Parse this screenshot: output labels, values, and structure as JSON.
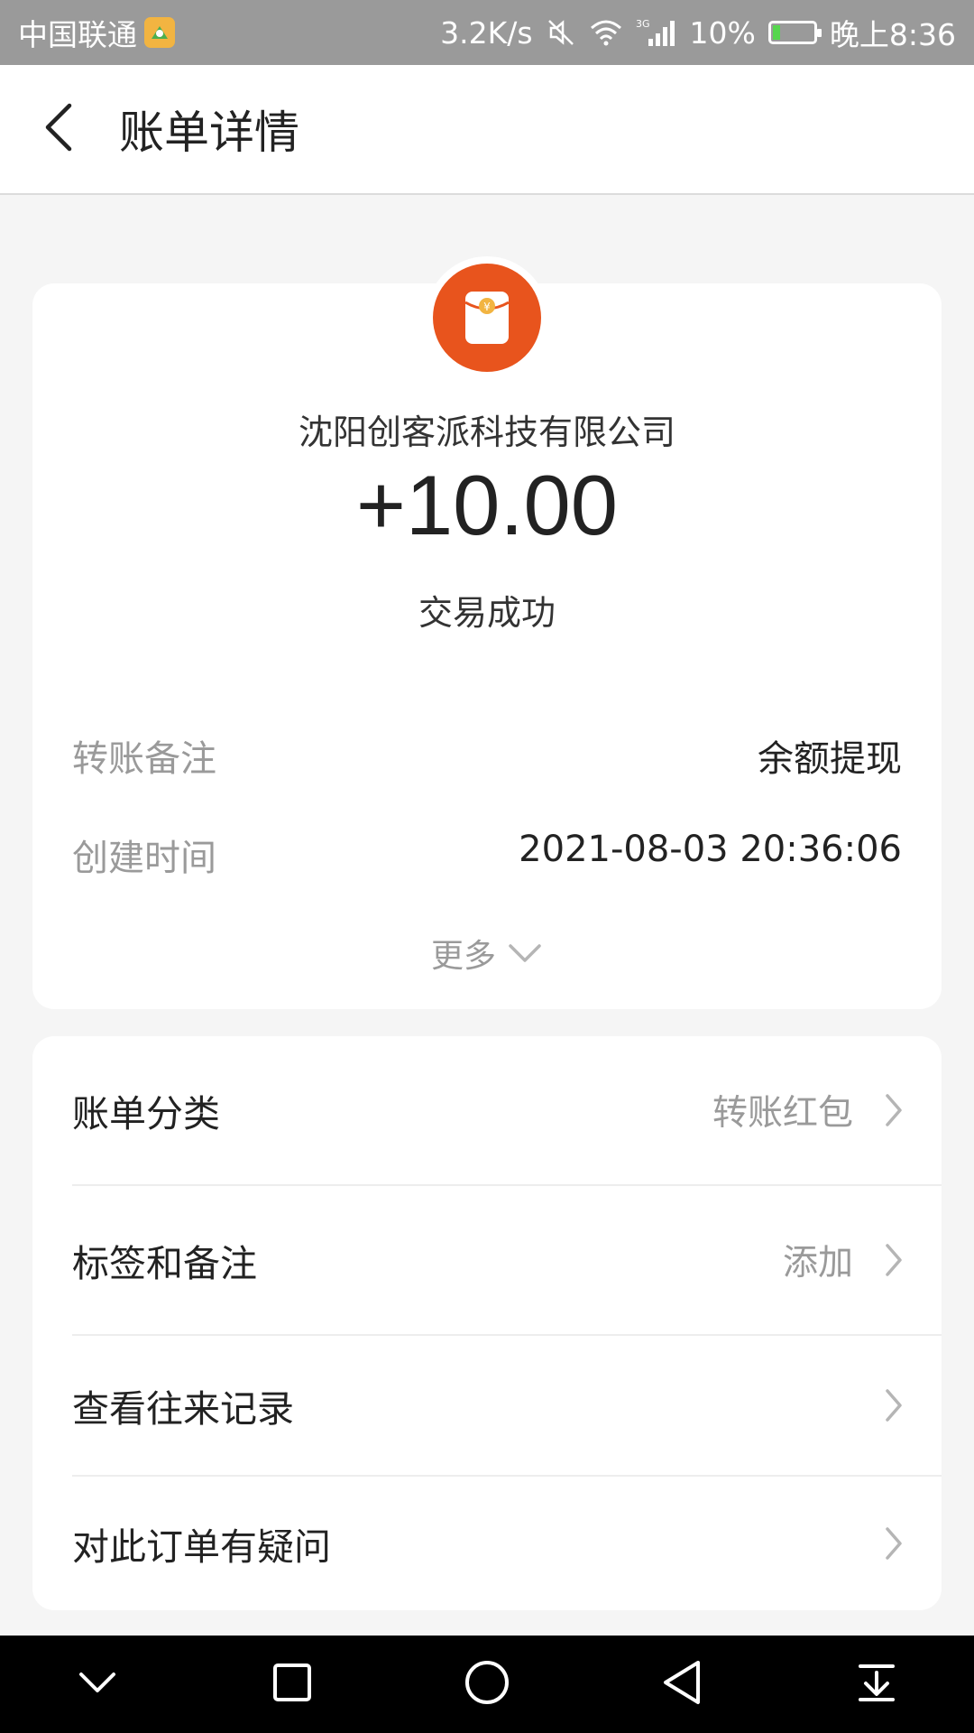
{
  "status_bar": {
    "carrier": "中国联通",
    "net_speed": "3.2K/s",
    "battery_level": "10%",
    "time": "晚上8:36",
    "icons": [
      "app-badge-icon",
      "mute-icon",
      "wifi-icon",
      "signal-3g-icon",
      "battery-icon"
    ]
  },
  "header": {
    "title": "账单详情",
    "back_icon": "back-arrow-icon"
  },
  "detail": {
    "avatar_icon": "red-envelope-icon",
    "merchant": "沈阳创客派科技有限公司",
    "amount": "+10.00",
    "status": "交易成功",
    "rows": [
      {
        "label": "转账备注",
        "value": "余额提现"
      },
      {
        "label": "创建时间",
        "value": "2021-08-03 20:36:06"
      }
    ],
    "more_label": "更多"
  },
  "actions": [
    {
      "label": "账单分类",
      "value": "转账红包"
    },
    {
      "label": "标签和备注",
      "value": "添加"
    },
    {
      "label": "查看往来记录",
      "value": ""
    },
    {
      "label": "对此订单有疑问",
      "value": ""
    }
  ],
  "nav_bar": {
    "icons": [
      "nav-collapse-icon",
      "nav-recent-icon",
      "nav-home-icon",
      "nav-back-icon",
      "nav-notification-icon"
    ]
  },
  "colors": {
    "accent": "#e8541d",
    "status_bar": "#9a9a9a",
    "muted_text": "#9a9a9a",
    "battery_low": "#56d64e"
  }
}
